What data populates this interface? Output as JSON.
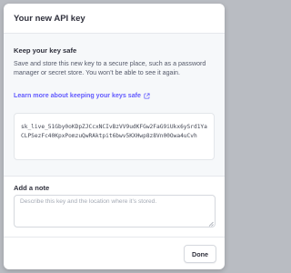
{
  "modal": {
    "title": "Your new API key",
    "keep_safe": {
      "heading": "Keep your key safe",
      "description": "Save and store this new key to a secure place, such as a password manager or secret store. You won’t be able to see it again.",
      "learn_more": "Learn more about keeping your keys safe",
      "learn_more_icon": "external-link-icon",
      "key_value": "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"
    },
    "note": {
      "heading": "Add a note",
      "placeholder": "Describe this key and the location where it’s stored."
    },
    "done_label": "Done"
  },
  "colors": {
    "accent": "#635bff",
    "backdrop": "#b9bcc2",
    "section_bg": "#f6f8fa"
  }
}
